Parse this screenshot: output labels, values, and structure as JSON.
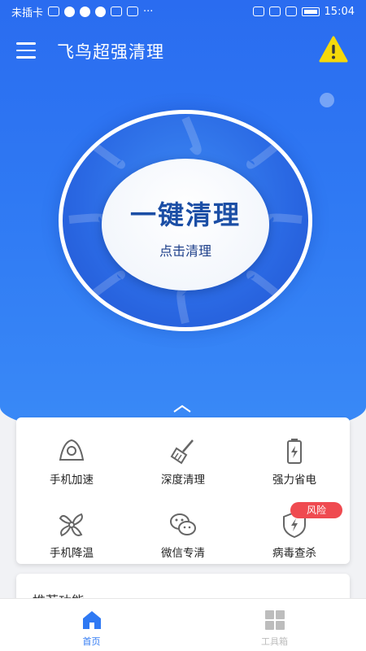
{
  "status_bar": {
    "carrier": "未插卡",
    "time": "15:04",
    "dots": "···"
  },
  "app_bar": {
    "title": "飞鸟超强清理",
    "menu_icon": "menu-icon",
    "warning_icon": "warning-icon"
  },
  "hero": {
    "main_label": "一键清理",
    "sub_label": "点击清理"
  },
  "tools": [
    {
      "label": "手机加速",
      "icon": "rocket-icon"
    },
    {
      "label": "深度清理",
      "icon": "broom-icon"
    },
    {
      "label": "强力省电",
      "icon": "battery-icon"
    },
    {
      "label": "手机降温",
      "icon": "fan-icon"
    },
    {
      "label": "微信专清",
      "icon": "wechat-icon"
    },
    {
      "label": "病毒查杀",
      "icon": "shield-icon"
    }
  ],
  "risk_badge": "风险",
  "recommend": {
    "title": "推荐功能"
  },
  "bottom_nav": [
    {
      "label": "首页",
      "icon": "home-icon",
      "active": true
    },
    {
      "label": "工具箱",
      "icon": "grid-icon",
      "active": false
    }
  ],
  "colors": {
    "primary": "#2f79f3",
    "accent_dark": "#1b4ea5",
    "warning": "#f5d90a",
    "badge": "#ef4a50",
    "icon_gray": "#666666",
    "nav_inactive": "#bdbdbd"
  }
}
